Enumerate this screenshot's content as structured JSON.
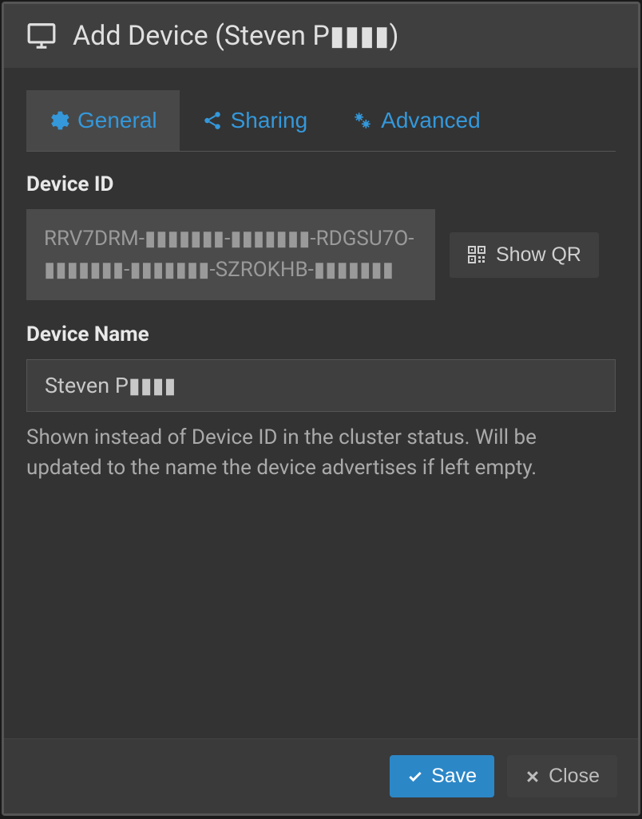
{
  "dialog": {
    "title": "Add Device (Steven P▮▮▮▮)"
  },
  "tabs": {
    "general": "General",
    "sharing": "Sharing",
    "advanced": "Advanced"
  },
  "form": {
    "device_id_label": "Device ID",
    "device_id_value": "RRV7DRM-▮▮▮▮▮▮▮-▮▮▮▮▮▮▮-RDGSU7O-▮▮▮▮▮▮▮-▮▮▮▮▮▮▮-SZROKHB-▮▮▮▮▮▮▮",
    "show_qr_label": "Show QR",
    "device_name_label": "Device Name",
    "device_name_value": "Steven P▮▮▮▮",
    "device_name_help": "Shown instead of Device ID in the cluster status. Will be updated to the name the device advertises if left empty."
  },
  "footer": {
    "save_label": "Save",
    "close_label": "Close"
  },
  "colors": {
    "accent": "#3498db",
    "primary_btn": "#2c87c7"
  }
}
